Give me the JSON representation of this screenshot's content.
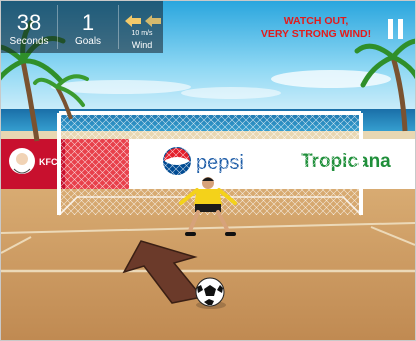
{
  "hud": {
    "seconds_value": "38",
    "seconds_label": "Seconds",
    "goals_value": "1",
    "goals_label": "Goals",
    "wind_speed": "10 m/s",
    "wind_label": "Wind",
    "warning_line1": "WATCH OUT,",
    "warning_line2": "VERY STRONG WIND!"
  },
  "billboards": {
    "kfc": "KFC",
    "pepsi": "pepsi",
    "tropicana": "Tropicana"
  },
  "icons": {
    "wind_arrows": "wind-direction-icon",
    "pause": "pause-icon"
  },
  "colors": {
    "warning": "#e31b1b",
    "sky_top": "#5fc5f0",
    "sand": "#c99a62",
    "goalkeeper_shirt": "#f4d21a",
    "aim_arrow": "#6b3a2a"
  }
}
